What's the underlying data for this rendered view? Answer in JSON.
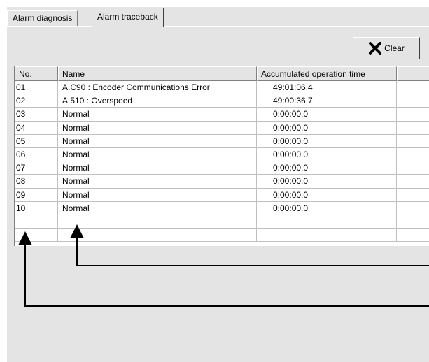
{
  "tabs": [
    {
      "label": "Alarm diagnosis",
      "active": false
    },
    {
      "label": "Alarm traceback",
      "active": true
    }
  ],
  "toolbar": {
    "clear_label": "Clear",
    "clear_icon": "x-icon"
  },
  "table": {
    "columns": [
      "No.",
      "Name",
      "Accumulated operation time",
      ""
    ],
    "rows": [
      {
        "no": "01",
        "name": "A.C90 : Encoder Communications Error",
        "time": "49:01:06.4"
      },
      {
        "no": "02",
        "name": "A.510 : Overspeed",
        "time": "49:00:36.7"
      },
      {
        "no": "03",
        "name": "Normal",
        "time": "0:00:00.0"
      },
      {
        "no": "04",
        "name": "Normal",
        "time": "0:00:00.0"
      },
      {
        "no": "05",
        "name": "Normal",
        "time": "0:00:00.0"
      },
      {
        "no": "06",
        "name": "Normal",
        "time": "0:00:00.0"
      },
      {
        "no": "07",
        "name": "Normal",
        "time": "0:00:00.0"
      },
      {
        "no": "08",
        "name": "Normal",
        "time": "0:00:00.0"
      },
      {
        "no": "09",
        "name": "Normal",
        "time": "0:00:00.0"
      },
      {
        "no": "10",
        "name": "Normal",
        "time": "0:00:00.0"
      },
      {
        "no": "",
        "name": "",
        "time": ""
      },
      {
        "no": "",
        "name": "",
        "time": ""
      }
    ]
  },
  "colors": {
    "panel": "#e4e4e4",
    "grid_line": "#c0c0c0",
    "annotation": "#000000"
  }
}
